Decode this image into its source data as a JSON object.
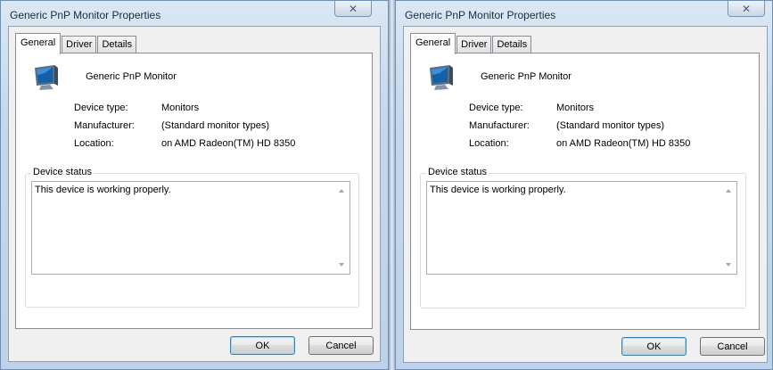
{
  "windows": [
    {
      "title": "Generic PnP Monitor Properties",
      "close_glyph": "✕",
      "tabs": [
        {
          "label": "General"
        },
        {
          "label": "Driver"
        },
        {
          "label": "Details"
        }
      ],
      "device_name": "Generic PnP Monitor",
      "icon": "monitor-icon",
      "properties": [
        {
          "label": "Device type:",
          "value": "Monitors"
        },
        {
          "label": "Manufacturer:",
          "value": "(Standard monitor types)"
        },
        {
          "label": "Location:",
          "value": "on AMD Radeon(TM) HD 8350"
        }
      ],
      "status_label": "Device status",
      "status_text": "This device is working properly.",
      "ok_label": "OK",
      "cancel_label": "Cancel"
    },
    {
      "title": "Generic PnP Monitor Properties",
      "close_glyph": "✕",
      "tabs": [
        {
          "label": "General"
        },
        {
          "label": "Driver"
        },
        {
          "label": "Details"
        }
      ],
      "device_name": "Generic PnP Monitor",
      "icon": "monitor-icon",
      "properties": [
        {
          "label": "Device type:",
          "value": "Monitors"
        },
        {
          "label": "Manufacturer:",
          "value": "(Standard monitor types)"
        },
        {
          "label": "Location:",
          "value": "on AMD Radeon(TM) HD 8350"
        }
      ],
      "status_label": "Device status",
      "status_text": "This device is working properly.",
      "ok_label": "OK",
      "cancel_label": "Cancel"
    }
  ],
  "colors": {
    "title_bar": "#c6d8eb",
    "client_bg": "#f0f0f0",
    "panel_bg": "#ffffff",
    "default_button_border": "#3c7fb1"
  }
}
